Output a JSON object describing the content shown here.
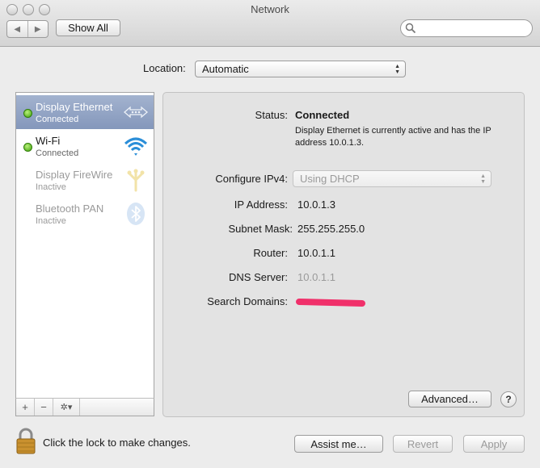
{
  "window": {
    "title": "Network"
  },
  "toolbar": {
    "show_all_label": "Show All",
    "back_glyph": "◀",
    "forward_glyph": "▶"
  },
  "location": {
    "label": "Location:",
    "value": "Automatic"
  },
  "services": [
    {
      "name": "Display Ethernet",
      "status": "Connected",
      "state": "connected",
      "icon": "ethernet-icon",
      "selected": true
    },
    {
      "name": "Wi-Fi",
      "status": "Connected",
      "state": "connected",
      "icon": "wifi-icon",
      "selected": false
    },
    {
      "name": "Display FireWire",
      "status": "Inactive",
      "state": "inactive",
      "icon": "firewire-icon",
      "selected": false
    },
    {
      "name": "Bluetooth PAN",
      "status": "Inactive",
      "state": "inactive",
      "icon": "bluetooth-icon",
      "selected": false
    }
  ],
  "sidebar_footer": {
    "add": "+",
    "remove": "−",
    "gear": "✲▾"
  },
  "details": {
    "status_label": "Status:",
    "status_value": "Connected",
    "status_desc": "Display Ethernet is currently active and has the IP address 10.0.1.3.",
    "configure_label": "Configure IPv4:",
    "configure_value": "Using DHCP",
    "ip_label": "IP Address:",
    "ip_value": "10.0.1.3",
    "subnet_label": "Subnet Mask:",
    "subnet_value": "255.255.255.0",
    "router_label": "Router:",
    "router_value": "10.0.1.1",
    "dns_label": "DNS Server:",
    "dns_value": "10.0.1.1",
    "search_label": "Search Domains:"
  },
  "buttons": {
    "advanced": "Advanced…",
    "help": "?",
    "assist": "Assist me…",
    "revert": "Revert",
    "apply": "Apply"
  },
  "lock": {
    "text": "Click the lock to make changes."
  },
  "colors": {
    "selection": "#8d9fc2",
    "status_green": "#3fa10b",
    "redaction": "#f0306a"
  }
}
